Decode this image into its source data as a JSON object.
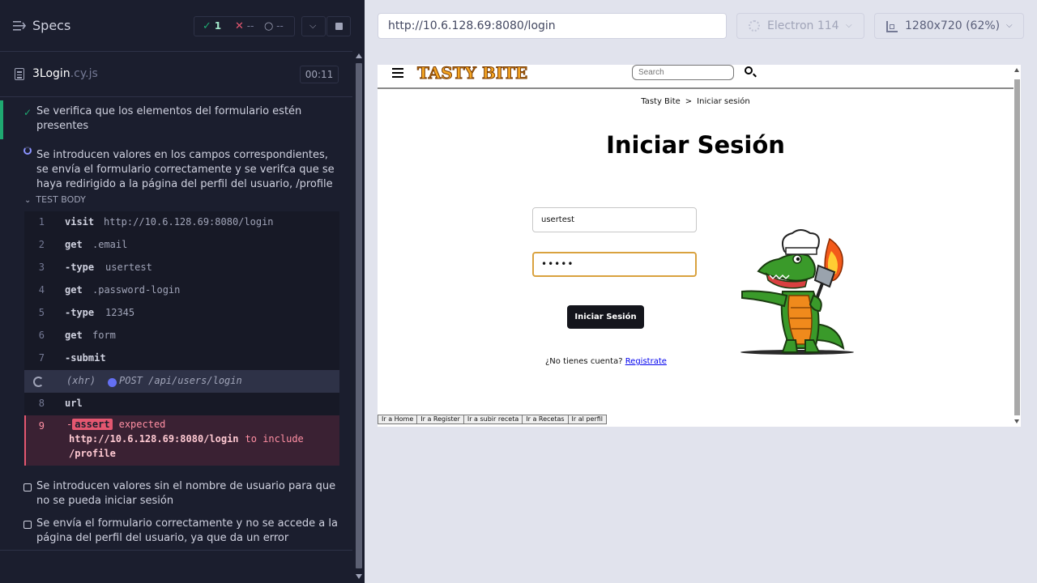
{
  "reporter": {
    "title": "Specs",
    "stats": {
      "passed": "1",
      "failed": "--",
      "pending": "--"
    },
    "spec": {
      "name": "3Login",
      "ext": ".cy.js",
      "duration": "00:11"
    },
    "tests": [
      {
        "title": "Se verifica que los elementos del formulario estén presentes",
        "state": "passed"
      },
      {
        "title": "Se introducen valores en los campos correspondientes, se envía el formulario correctamente y se verifca que se haya redirigido a la página del perfil del usuario, /profile",
        "state": "running"
      },
      {
        "title": "Se introducen valores sin el nombre de usuario para que no se pueda iniciar sesión",
        "state": "pending"
      },
      {
        "title": "Se envía el formulario correctamente y no se accede a la página del perfil del usuario, ya que da un error",
        "state": "pending"
      }
    ],
    "test_body_label": "TEST BODY",
    "commands": [
      {
        "num": "1",
        "name": "visit",
        "message": "http://10.6.128.69:8080/login"
      },
      {
        "num": "2",
        "name": "get",
        "message": ".email"
      },
      {
        "num": "3",
        "name": "-type",
        "message": "usertest"
      },
      {
        "num": "4",
        "name": "get",
        "message": ".password-login"
      },
      {
        "num": "5",
        "name": "-type",
        "message": "12345"
      },
      {
        "num": "6",
        "name": "get",
        "message": "form"
      },
      {
        "num": "7",
        "name": "-submit",
        "message": ""
      },
      {
        "num": "",
        "name": "(xhr)",
        "message": "POST /api/users/login"
      },
      {
        "num": "8",
        "name": "url",
        "message": ""
      },
      {
        "num": "9",
        "name": "assert",
        "message": "expected"
      }
    ],
    "assertion": {
      "dash": "-",
      "tag": "assert",
      "expected_label": "expected",
      "actual": "http://10.6.128.69:8080/login",
      "to_include": "to include",
      "expected": "/profile"
    }
  },
  "runner": {
    "url": "http://10.6.128.69:8080/login",
    "browser": "Electron 114",
    "viewport": "1280x720 (62%)"
  },
  "aut": {
    "logo": "TASTY BITE",
    "search_placeholder": "Search",
    "breadcrumb": {
      "home": "Tasty Bite",
      "sep": ">",
      "current": "Iniciar sesión"
    },
    "title": "Iniciar Sesión",
    "username_value": "usertest",
    "password_value": "•••••",
    "login_button": "Iniciar Sesión",
    "no_account_text": "¿No tienes cuenta?",
    "register_link": "Registrate",
    "footer_buttons": [
      "Ir a Home",
      "Ir a Register",
      "Ir a subir receta",
      "Ir a Recetas",
      "Ir al perfil"
    ]
  },
  "colors": {
    "passed": "#1fa971",
    "failed": "#e45770",
    "running": "#6470f3",
    "reporter_bg": "#1b1e2e",
    "runner_bg": "#e1e3ed",
    "focus_border": "#d9a23f"
  }
}
